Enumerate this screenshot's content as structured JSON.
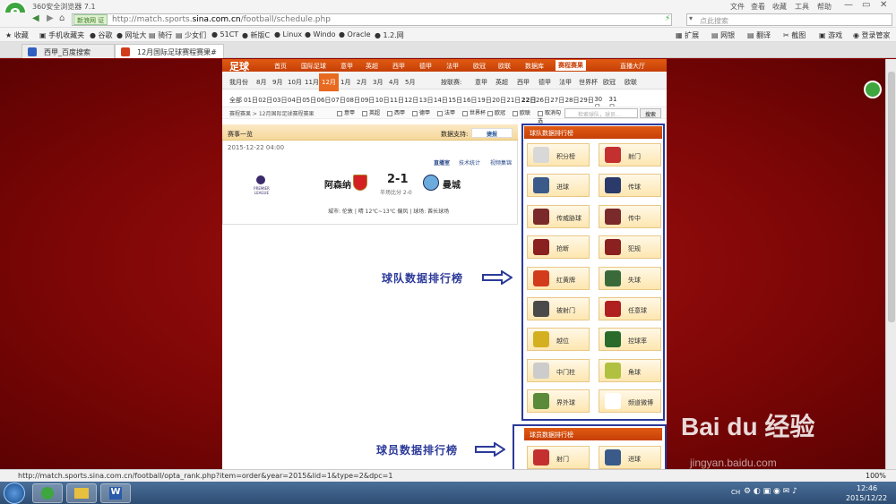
{
  "browser": {
    "title": "360安全浏览器 7.1",
    "menu": [
      "文件",
      "查看",
      "收藏",
      "工具",
      "帮助"
    ],
    "url_prefix": "http://match.sports.",
    "url_domain": "sina.com.cn",
    "url_path": "/football/schedule.php",
    "url_tag": "新浪网 证",
    "search_placeholder": "点此搜索",
    "bookmarks": [
      "收藏",
      "手机收藏夹",
      "谷歌",
      "网址大",
      "骑行",
      "少女们",
      "51CT",
      "新版C",
      "Linux",
      "Windo",
      "Oracle",
      "1.2.网"
    ],
    "right_tools": [
      "扩展",
      "网银",
      "翻译",
      "截图",
      "游戏",
      "登录管家"
    ],
    "tabs": [
      {
        "label": "西甲_百度搜索",
        "active": false
      },
      {
        "label": "12月国际足球赛程赛果#",
        "active": true
      }
    ],
    "status_url": "http://match.sports.sina.com.cn/football/opta_rank.php?item=order&year=2015&lid=1&type=2&dpc=1",
    "zoom": "100%",
    "clock_time": "12:46",
    "clock_date": "2015/12/22",
    "tray_lang": "CH"
  },
  "site": {
    "logo": "足球",
    "nav": [
      "首页",
      "国际足球",
      "意甲",
      "英超",
      "西甲",
      "德甲",
      "法甲",
      "欧冠",
      "欧联",
      "数据库",
      "赛程赛果",
      "直播大厅"
    ],
    "nav_active": "赛程赛果",
    "months_label": "我月份",
    "months": [
      "8月",
      "9月",
      "10月",
      "11月",
      "12月",
      "1月",
      "2月",
      "3月",
      "4月",
      "5月"
    ],
    "month_active": "12月",
    "league_label": "按联赛:",
    "leagues": [
      "意甲",
      "英超",
      "西甲",
      "德甲",
      "法甲",
      "世界杯",
      "欧冠",
      "欧联"
    ],
    "dates_all": "全部",
    "dates": [
      "01日",
      "02日",
      "03日",
      "04日",
      "05日",
      "06日",
      "07日",
      "08日",
      "09日",
      "10日",
      "11日",
      "12日",
      "13日",
      "14日",
      "15日",
      "16日",
      "19日",
      "20日",
      "21日",
      "22日",
      "26日",
      "27日",
      "28日",
      "29日",
      "30日",
      "31日"
    ],
    "breadcrumb": "赛程赛果 > 12月国际足球赛程赛果",
    "filter_items": [
      "意甲",
      "英超",
      "西甲",
      "德甲",
      "法甲",
      "世界杯",
      "欧冠",
      "欧联",
      "取消勾选"
    ],
    "search_placeholder": "检索球队，球员...",
    "search_button": "搜索"
  },
  "match": {
    "panel_title": "赛事一览",
    "data_support": "数据支持:",
    "data_provider": "捷报",
    "datetime": "2015-12-22 04:00",
    "links": [
      "直播室",
      "技术统计",
      "视频集锦"
    ],
    "home": "阿森纳",
    "away": "曼城",
    "score": "2-1",
    "halftime": "半场比分 2-0",
    "league_logo_text": "PREMIER LEAGUE",
    "info": "城市: 伦敦 | 晴 12℃~13℃ 偏风 | 球场: 酋长球场"
  },
  "team_rank": {
    "title": "球队数据排行榜",
    "items": [
      {
        "label": "积分榜",
        "icon": "table-icon",
        "color": "#d8d8d8"
      },
      {
        "label": "射门",
        "icon": "shot-icon",
        "color": "#c43030"
      },
      {
        "label": "进球",
        "icon": "goal-icon",
        "color": "#3a5a8a"
      },
      {
        "label": "传球",
        "icon": "pass-icon",
        "color": "#2a3a6a"
      },
      {
        "label": "传威胁球",
        "icon": "through-ball-icon",
        "color": "#7a2a2a"
      },
      {
        "label": "传中",
        "icon": "cross-icon",
        "color": "#7a2a2a"
      },
      {
        "label": "抢断",
        "icon": "tackle-icon",
        "color": "#8a2020"
      },
      {
        "label": "犯规",
        "icon": "foul-icon",
        "color": "#8a2020"
      },
      {
        "label": "红黄牌",
        "icon": "card-icon",
        "color": "#d23c1c"
      },
      {
        "label": "失球",
        "icon": "concede-icon",
        "color": "#3a6a3a"
      },
      {
        "label": "被射门",
        "icon": "shot-against-icon",
        "color": "#4a4a4a"
      },
      {
        "label": "任意球",
        "icon": "free-kick-icon",
        "color": "#b02020"
      },
      {
        "label": "越位",
        "icon": "offside-icon",
        "color": "#d4b020"
      },
      {
        "label": "控球率",
        "icon": "possession-icon",
        "color": "#2a6a2a"
      },
      {
        "label": "中门柱",
        "icon": "post-icon",
        "color": "#cccccc"
      },
      {
        "label": "角球",
        "icon": "corner-icon",
        "color": "#b0c040"
      },
      {
        "label": "界外球",
        "icon": "throw-in-icon",
        "color": "#5a8a3a"
      },
      {
        "label": "频道微博",
        "icon": "weibo-icon",
        "color": "#ffffff"
      }
    ]
  },
  "player_rank": {
    "title": "球员数据排行榜",
    "items": [
      {
        "label": "射门",
        "icon": "shot-icon",
        "color": "#c43030"
      },
      {
        "label": "进球",
        "icon": "goal-icon",
        "color": "#3a5a8a"
      }
    ]
  },
  "annotations": {
    "team": "球队数据排行榜",
    "player": "球员数据排行榜"
  },
  "watermark": "Bai du 经验",
  "watermark_sub": "jingyan.baidu.com"
}
